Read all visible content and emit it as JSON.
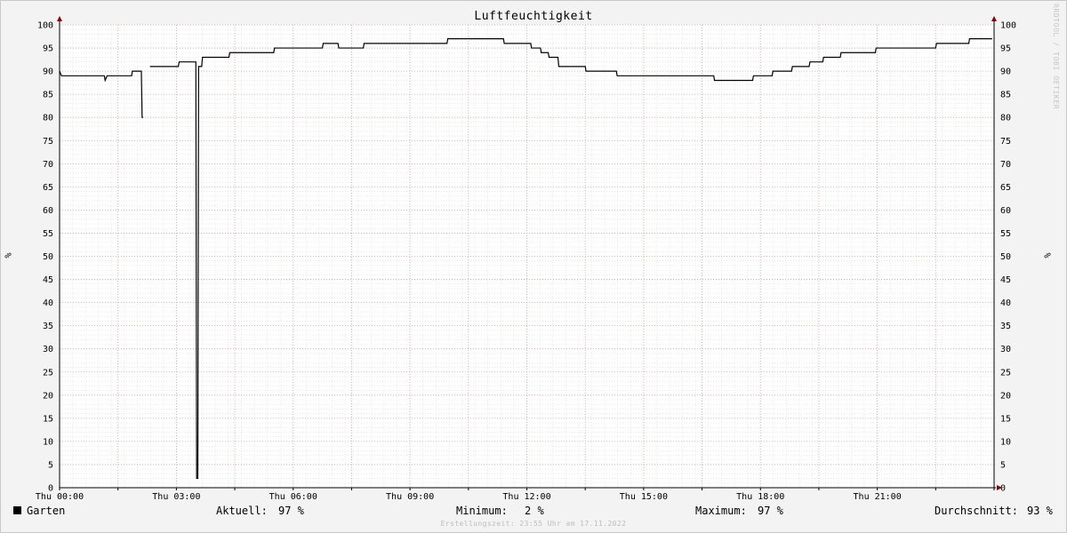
{
  "chart_data": {
    "type": "line",
    "title": "Luftfeuchtigkeit",
    "ylabel_left": "%",
    "ylabel_right": "%",
    "ylim": [
      0,
      100
    ],
    "yticks": [
      0,
      5,
      10,
      15,
      20,
      25,
      30,
      35,
      40,
      45,
      50,
      55,
      60,
      65,
      70,
      75,
      80,
      85,
      90,
      95,
      100
    ],
    "xlim": [
      0,
      24
    ],
    "xticks": [
      {
        "label": "Thu 00:00",
        "hour": 0
      },
      {
        "label": "Thu 03:00",
        "hour": 3
      },
      {
        "label": "Thu 06:00",
        "hour": 6
      },
      {
        "label": "Thu 09:00",
        "hour": 9
      },
      {
        "label": "Thu 12:00",
        "hour": 12
      },
      {
        "label": "Thu 15:00",
        "hour": 15
      },
      {
        "label": "Thu 18:00",
        "hour": 18
      },
      {
        "label": "Thu 21:00",
        "hour": 21
      }
    ],
    "grid": true,
    "series": [
      {
        "name": "Garten",
        "color": "#000000",
        "segments": [
          [
            [
              0,
              90
            ],
            [
              0.05,
              89
            ],
            [
              1.15,
              89
            ],
            [
              1.17,
              88
            ],
            [
              1.22,
              89
            ],
            [
              1.85,
              89
            ],
            [
              1.87,
              90
            ],
            [
              2.1,
              90
            ],
            [
              2.12,
              80
            ],
            [
              2.15,
              80
            ]
          ],
          [
            [
              2.32,
              91
            ],
            [
              3.05,
              91
            ],
            [
              3.07,
              92
            ],
            [
              3.5,
              92
            ],
            [
              3.52,
              2
            ],
            [
              3.55,
              2
            ],
            [
              3.57,
              91
            ],
            [
              3.65,
              91
            ],
            [
              3.67,
              93
            ],
            [
              4.35,
              93
            ],
            [
              4.37,
              94
            ],
            [
              5.5,
              94
            ],
            [
              5.52,
              95
            ],
            [
              6.75,
              95
            ],
            [
              6.77,
              96
            ],
            [
              7.15,
              96
            ],
            [
              7.17,
              95
            ],
            [
              7.8,
              95
            ],
            [
              7.82,
              96
            ],
            [
              9.95,
              96
            ],
            [
              9.97,
              97
            ],
            [
              11.4,
              97
            ],
            [
              11.42,
              96
            ],
            [
              12.1,
              96
            ],
            [
              12.12,
              95
            ],
            [
              12.35,
              95
            ],
            [
              12.37,
              94
            ],
            [
              12.55,
              94
            ],
            [
              12.57,
              93
            ],
            [
              12.8,
              93
            ],
            [
              12.82,
              91
            ],
            [
              13.5,
              91
            ],
            [
              13.52,
              90
            ],
            [
              14.3,
              90
            ],
            [
              14.32,
              89
            ],
            [
              16.8,
              89
            ],
            [
              16.82,
              88
            ],
            [
              17.8,
              88
            ],
            [
              17.82,
              89
            ],
            [
              18.3,
              89
            ],
            [
              18.32,
              90
            ],
            [
              18.8,
              90
            ],
            [
              18.82,
              91
            ],
            [
              19.25,
              91
            ],
            [
              19.27,
              92
            ],
            [
              19.6,
              92
            ],
            [
              19.62,
              93
            ],
            [
              20.05,
              93
            ],
            [
              20.07,
              94
            ],
            [
              20.95,
              94
            ],
            [
              20.97,
              95
            ],
            [
              22.5,
              95
            ],
            [
              22.52,
              96
            ],
            [
              23.35,
              96
            ],
            [
              23.37,
              97
            ],
            [
              23.95,
              97
            ]
          ]
        ]
      }
    ],
    "stats": {
      "current_label": "Aktuell:",
      "current_value": "97 %",
      "min_label": "Minimum:",
      "min_value": "2 %",
      "max_label": "Maximum:",
      "max_value": "97 %",
      "avg_label": "Durchschnitt:",
      "avg_value": "93 %"
    },
    "footer": "Erstellungszeit: 23:55 Uhr am 17.11.2022",
    "watermark": "RRDTOOL / TOBI OETIKER"
  }
}
